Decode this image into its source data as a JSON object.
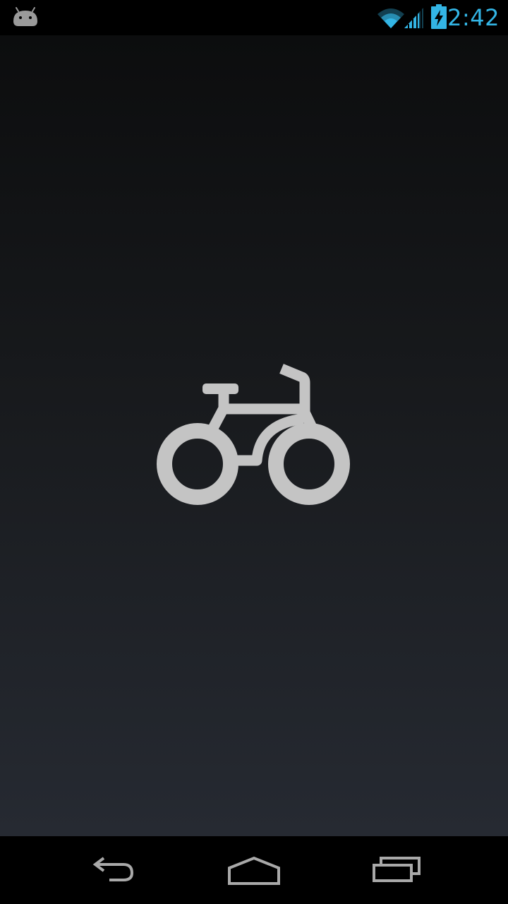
{
  "status_bar": {
    "time": "2:42",
    "left_icon": "android-icon",
    "right_icons": [
      "wifi-icon",
      "signal-icon",
      "battery-charging-icon"
    ],
    "accent_color": "#33b5e5"
  },
  "main": {
    "icon": "bicycle-icon",
    "icon_color": "#c4c4c4"
  },
  "navigation_bar": {
    "buttons": [
      "back-icon",
      "home-icon",
      "recents-icon"
    ]
  }
}
